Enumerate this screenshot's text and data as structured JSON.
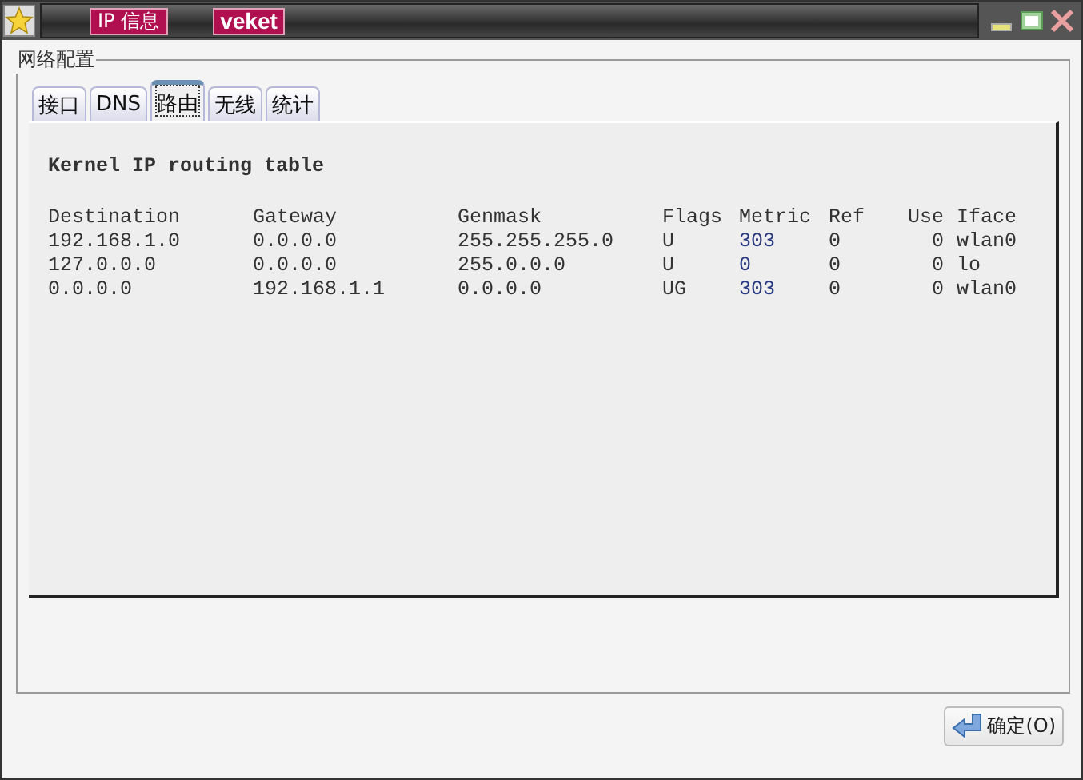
{
  "window": {
    "title_tags": [
      "IP 信息",
      "veket"
    ]
  },
  "group": {
    "title": "网络配置"
  },
  "tabs": [
    {
      "label": "接口",
      "selected": false
    },
    {
      "label": "DNS",
      "selected": false
    },
    {
      "label": "路由",
      "selected": true
    },
    {
      "label": "无线",
      "selected": false
    },
    {
      "label": "统计",
      "selected": false
    }
  ],
  "routing": {
    "heading": "Kernel IP routing table",
    "columns": [
      "Destination",
      "Gateway",
      "Genmask",
      "Flags",
      "Metric",
      "Ref",
      "Use",
      "Iface"
    ],
    "rows": [
      [
        "192.168.1.0",
        "0.0.0.0",
        "255.255.255.0",
        "U",
        "303",
        "0",
        "0",
        "wlan0"
      ],
      [
        "127.0.0.0",
        "0.0.0.0",
        "255.0.0.0",
        "U",
        "0",
        "0",
        "0",
        "lo"
      ],
      [
        "0.0.0.0",
        "192.168.1.1",
        "0.0.0.0",
        "UG",
        "303",
        "0",
        "0",
        "wlan0"
      ]
    ]
  },
  "buttons": [
    {
      "label": "确定(O)"
    }
  ]
}
